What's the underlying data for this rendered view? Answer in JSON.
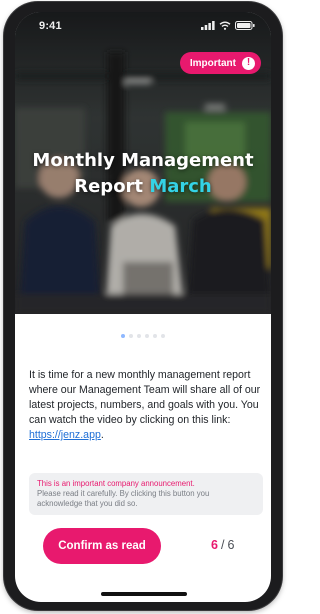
{
  "status_bar": {
    "time": "9:41"
  },
  "hero": {
    "badge_label": "Important",
    "badge_icon": "exclamation-circle-icon",
    "title_line1": "Monthly Management",
    "title_line2_main": "Report",
    "title_line2_accent": "March"
  },
  "pager": {
    "total": 6,
    "active_index": 0
  },
  "body": {
    "text": "It is time for a new monthly management report where our Management Team will share all of our latest projects, numbers, and goals with you. You can watch the video by clicking on this link: ",
    "link_text": "https://jenz.app",
    "trailing": "."
  },
  "notice": {
    "title": "This is an important company announcement.",
    "text": "Please read it carefully. By clicking this button you acknowledge that you did so."
  },
  "actions": {
    "confirm_label": "Confirm as read",
    "current_page": "6",
    "separator": "/",
    "total_pages": "6"
  },
  "colors": {
    "brand_pink": "#e8196e",
    "accent_cyan": "#34d3e6",
    "link_blue": "#1f6fd6"
  }
}
